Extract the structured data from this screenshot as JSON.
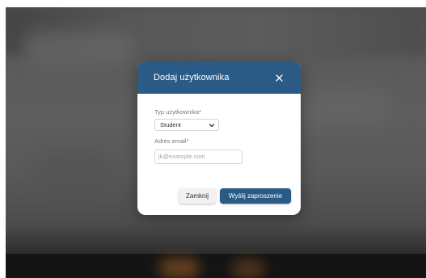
{
  "dialog": {
    "title": "Dodaj użytkownika",
    "close_icon": "close-icon",
    "user_type": {
      "label": "Typ użytkownika*",
      "selected": "Student"
    },
    "email": {
      "label": "Adres email*",
      "value": "",
      "placeholder": "jk@example.com"
    },
    "buttons": {
      "close_label": "Zamknij",
      "send_label": "Wyślij zaproszenie"
    }
  },
  "colors": {
    "header": "#2a5b87",
    "primary_button": "#2a5b87",
    "secondary_button": "#f1f1f1",
    "overlay": "#5a5a5a"
  }
}
